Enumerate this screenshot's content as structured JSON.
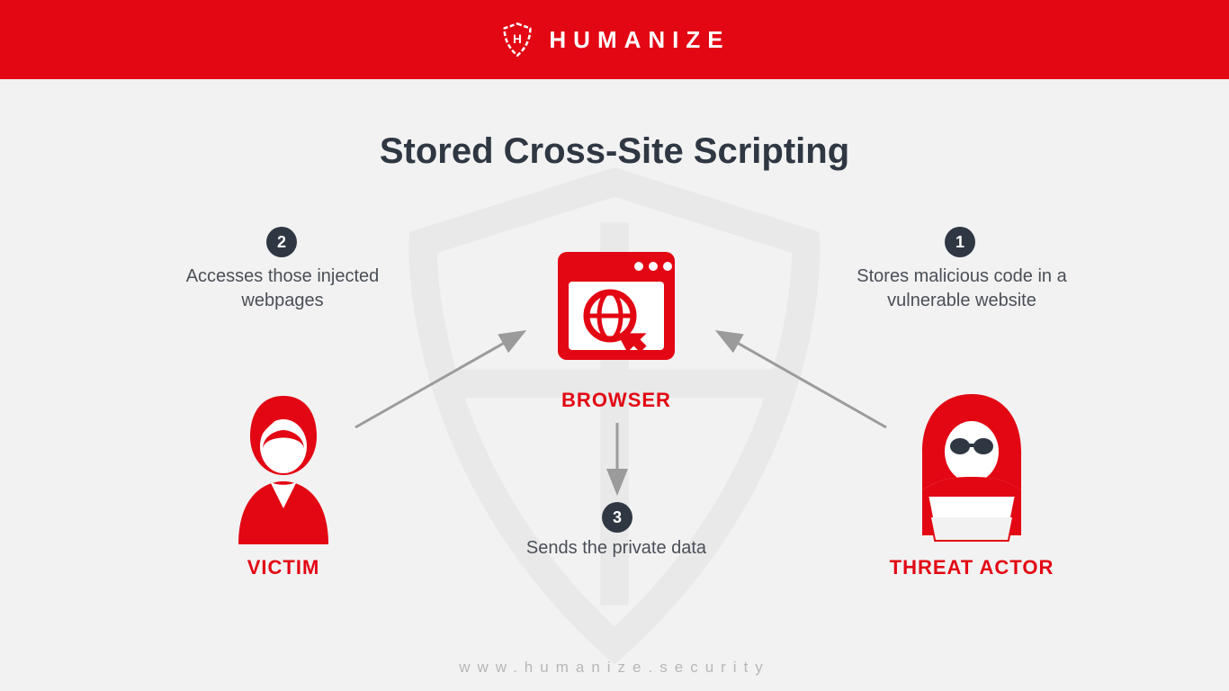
{
  "brand": "HUMANIZE",
  "title": "Stored Cross-Site Scripting",
  "steps": {
    "s1": {
      "num": "1",
      "text": "Stores malicious code in a vulnerable website"
    },
    "s2": {
      "num": "2",
      "text": "Accesses those injected webpages"
    },
    "s3": {
      "num": "3",
      "text": "Sends the private data"
    }
  },
  "nodes": {
    "browser": "BROWSER",
    "victim": "VICTIM",
    "threat_actor": "THREAT ACTOR"
  },
  "footer_url": "www.humanize.security",
  "colors": {
    "brand_red": "#e30613",
    "dark": "#2f3743",
    "bg": "#f2f2f2",
    "grey_arrow": "#9b9b9b"
  }
}
